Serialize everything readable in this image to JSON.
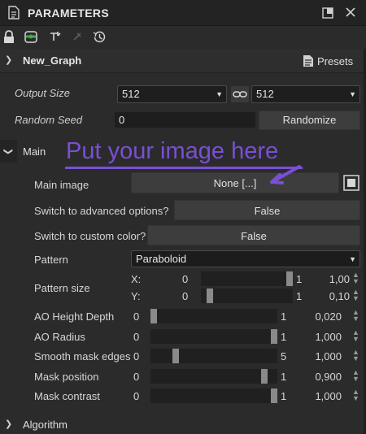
{
  "window": {
    "title": "PARAMETERS"
  },
  "graph": {
    "name": "New_Graph",
    "presets_label": "Presets"
  },
  "params": {
    "output_size_label": "Output Size",
    "output_size_w": "512",
    "output_size_h": "512",
    "random_seed_label": "Random Seed",
    "random_seed_value": "0",
    "randomize_label": "Randomize"
  },
  "main_section": {
    "label": "Main",
    "overlay_text": "Put your image here",
    "main_image_label": "Main image",
    "main_image_value": "None [...]",
    "advanced_label": "Switch to advanced options?",
    "advanced_value": "False",
    "custom_color_label": "Switch to custom color?",
    "custom_color_value": "False",
    "pattern_label": "Pattern",
    "pattern_value": "Paraboloid",
    "pattern_size_label": "Pattern size",
    "pattern_size": {
      "x_label": "X:",
      "y_label": "Y:",
      "x_min": "0",
      "x_max": "1",
      "x_value": "1,00",
      "x_fraction": 1.0,
      "y_min": "0",
      "y_max": "1",
      "y_value": "0,10",
      "y_fraction": 0.1
    },
    "sliders": [
      {
        "label": "AO Height Depth",
        "min": "0",
        "max": "1",
        "value": "0,020",
        "fraction": 0.02
      },
      {
        "label": "AO Radius",
        "min": "0",
        "max": "1",
        "value": "1,000",
        "fraction": 1.0
      },
      {
        "label": "Smooth mask edges",
        "min": "0",
        "max": "5",
        "value": "1,000",
        "fraction": 0.2
      },
      {
        "label": "Mask position",
        "min": "0",
        "max": "1",
        "value": "0,900",
        "fraction": 0.9
      },
      {
        "label": "Mask contrast",
        "min": "0",
        "max": "1",
        "value": "1,000",
        "fraction": 1.0
      }
    ]
  },
  "algorithm_section": {
    "label": "Algorithm"
  },
  "colors": {
    "accent_overlay": "#7a4fd6",
    "panel_bg": "#2b2b2b"
  },
  "icons": [
    "document-icon",
    "maximize-icon",
    "close-icon",
    "lock-icon",
    "graph-link-icon",
    "pin-icon",
    "history-icon",
    "presets-icon",
    "link-icon",
    "fit-icon",
    "arrow-annotation-icon"
  ]
}
